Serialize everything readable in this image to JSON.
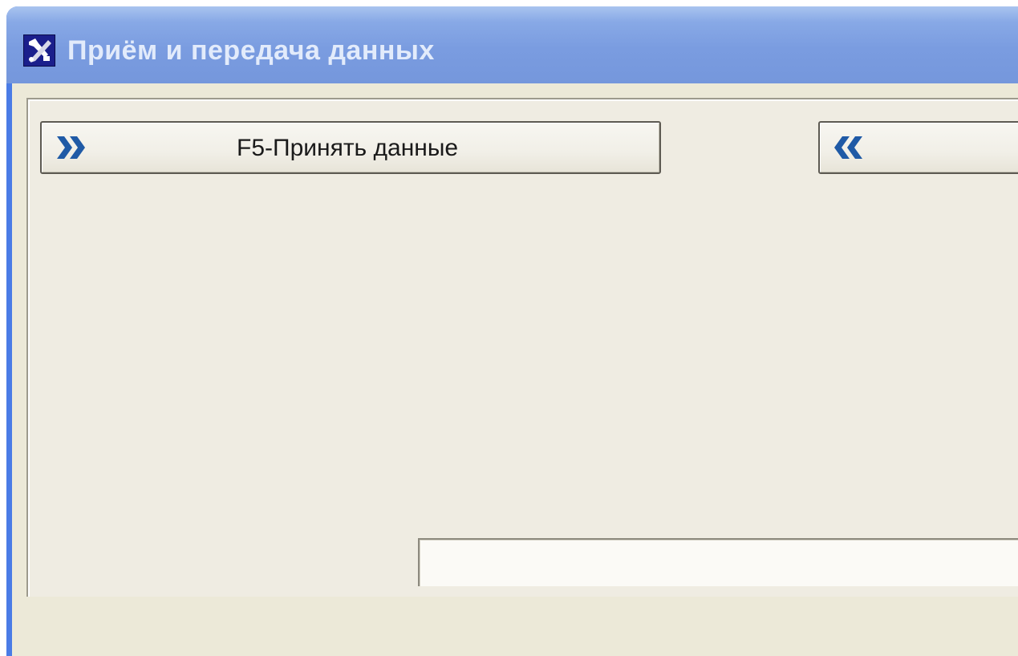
{
  "window": {
    "title": "Приём и передача данных",
    "icon": "app-tools-icon"
  },
  "actions": {
    "receive": {
      "label": "F5-Принять данные",
      "icon": "double-chevron-right-icon"
    },
    "send": {
      "label": "",
      "icon": "double-chevron-left-icon"
    }
  },
  "colors": {
    "titlebar": "#7a9ce0",
    "title_text": "#e2ebfb",
    "window_bg": "#ece9d8",
    "chevron": "#1f5aa6"
  }
}
